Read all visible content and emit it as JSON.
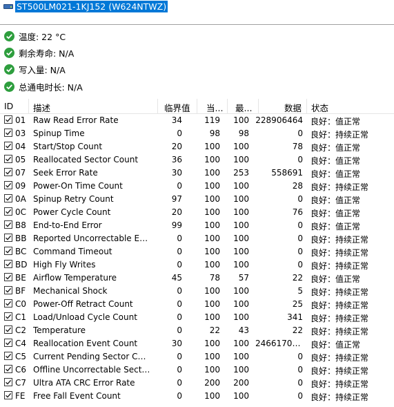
{
  "drive_title": "ST500LM021-1KJ152 (W624NTWZ)",
  "summary": [
    {
      "icon": "check-icon",
      "text": "温度: 22 °C"
    },
    {
      "icon": "check-icon",
      "text": "剩余寿命: N/A"
    },
    {
      "icon": "check-icon",
      "text": "写入量: N/A"
    },
    {
      "icon": "check-icon",
      "text": "总通电时长: N/A"
    }
  ],
  "table": {
    "headers": {
      "id": "ID",
      "desc": "描述",
      "threshold": "临界值",
      "current": "当...",
      "worst": "最...",
      "raw": "数据",
      "status": "状态"
    },
    "rows": [
      {
        "id": "01",
        "desc": "Raw Read Error Rate",
        "threshold": "34",
        "current": "119",
        "worst": "100",
        "raw": "228906464",
        "status": "良好：值正常"
      },
      {
        "id": "03",
        "desc": "Spinup Time",
        "threshold": "0",
        "current": "98",
        "worst": "98",
        "raw": "0",
        "status": "良好：持续正常"
      },
      {
        "id": "04",
        "desc": "Start/Stop Count",
        "threshold": "20",
        "current": "100",
        "worst": "100",
        "raw": "78",
        "status": "良好：值正常"
      },
      {
        "id": "05",
        "desc": "Reallocated Sector Count",
        "threshold": "36",
        "current": "100",
        "worst": "100",
        "raw": "0",
        "status": "良好：值正常"
      },
      {
        "id": "07",
        "desc": "Seek Error Rate",
        "threshold": "30",
        "current": "100",
        "worst": "253",
        "raw": "558691",
        "status": "良好：值正常"
      },
      {
        "id": "09",
        "desc": "Power-On Time Count",
        "threshold": "0",
        "current": "100",
        "worst": "100",
        "raw": "28",
        "status": "良好：持续正常"
      },
      {
        "id": "0A",
        "desc": "Spinup Retry Count",
        "threshold": "97",
        "current": "100",
        "worst": "100",
        "raw": "0",
        "status": "良好：值正常"
      },
      {
        "id": "0C",
        "desc": "Power Cycle Count",
        "threshold": "20",
        "current": "100",
        "worst": "100",
        "raw": "76",
        "status": "良好：值正常"
      },
      {
        "id": "B8",
        "desc": "End-to-End Error",
        "threshold": "99",
        "current": "100",
        "worst": "100",
        "raw": "0",
        "status": "良好：值正常"
      },
      {
        "id": "BB",
        "desc": "Reported Uncorrectable Errors",
        "threshold": "0",
        "current": "100",
        "worst": "100",
        "raw": "0",
        "status": "良好：持续正常"
      },
      {
        "id": "BC",
        "desc": "Command Timeout",
        "threshold": "0",
        "current": "100",
        "worst": "100",
        "raw": "0",
        "status": "良好：持续正常"
      },
      {
        "id": "BD",
        "desc": "High Fly Writes",
        "threshold": "0",
        "current": "100",
        "worst": "100",
        "raw": "0",
        "status": "良好：持续正常"
      },
      {
        "id": "BE",
        "desc": "Airflow Temperature",
        "threshold": "45",
        "current": "78",
        "worst": "57",
        "raw": "22",
        "status": "良好：值正常"
      },
      {
        "id": "BF",
        "desc": "Mechanical Shock",
        "threshold": "0",
        "current": "100",
        "worst": "100",
        "raw": "5",
        "status": "良好：持续正常"
      },
      {
        "id": "C0",
        "desc": "Power-Off Retract Count",
        "threshold": "0",
        "current": "100",
        "worst": "100",
        "raw": "25",
        "status": "良好：持续正常"
      },
      {
        "id": "C1",
        "desc": "Load/Unload Cycle Count",
        "threshold": "0",
        "current": "100",
        "worst": "100",
        "raw": "341",
        "status": "良好：持续正常"
      },
      {
        "id": "C2",
        "desc": "Temperature",
        "threshold": "0",
        "current": "22",
        "worst": "43",
        "raw": "22",
        "status": "良好：持续正常"
      },
      {
        "id": "C4",
        "desc": "Reallocation Event Count",
        "threshold": "30",
        "current": "100",
        "worst": "100",
        "raw": "24661702...",
        "status": "良好：值正常"
      },
      {
        "id": "C5",
        "desc": "Current Pending Sector Count",
        "threshold": "0",
        "current": "100",
        "worst": "100",
        "raw": "0",
        "status": "良好：持续正常"
      },
      {
        "id": "C6",
        "desc": "Offline Uncorrectable Sector C...",
        "threshold": "0",
        "current": "100",
        "worst": "100",
        "raw": "0",
        "status": "良好：持续正常"
      },
      {
        "id": "C7",
        "desc": "Ultra ATA CRC Error Rate",
        "threshold": "0",
        "current": "200",
        "worst": "200",
        "raw": "0",
        "status": "良好：持续正常"
      },
      {
        "id": "FE",
        "desc": "Free Fall Event Count",
        "threshold": "0",
        "current": "100",
        "worst": "100",
        "raw": "0",
        "status": "良好：持续正常"
      }
    ]
  }
}
